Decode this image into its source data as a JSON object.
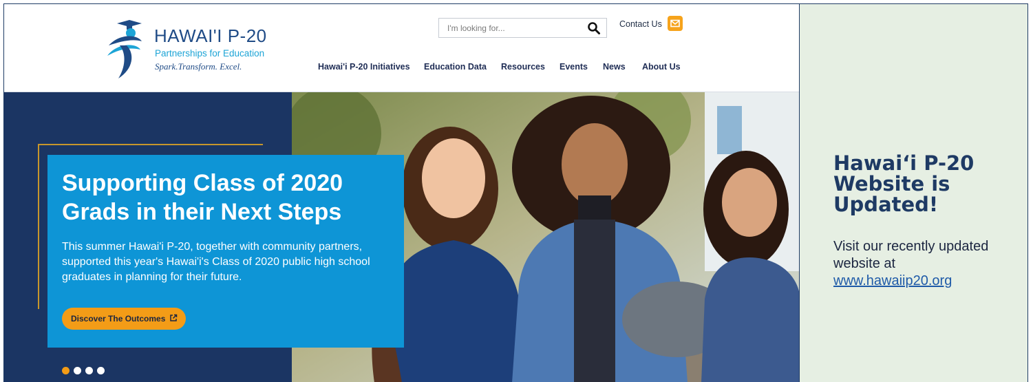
{
  "header": {
    "logo": {
      "title": "HAWAI'I P-20",
      "subtitle": "Partnerships for Education",
      "tagline": "Spark.Transform. Excel."
    },
    "search": {
      "placeholder": "I'm looking for...",
      "value": ""
    },
    "contact_label": "Contact Us",
    "nav": [
      {
        "label": "Hawai'i P-20 Initiatives"
      },
      {
        "label": "Education Data"
      },
      {
        "label": "Resources"
      },
      {
        "label": "Events"
      },
      {
        "label": "News"
      },
      {
        "label": "About Us"
      }
    ]
  },
  "hero": {
    "title": "Supporting Class of 2020 Grads in their Next Steps",
    "text": "This summer Hawai'i P-20, together with community partners, supported this year's Hawai'i's Class of 2020 public high school graduates in planning for their future.",
    "button_label": "Discover The Outcomes",
    "slides_total": 4,
    "slide_active": 1
  },
  "announcement": {
    "title": "Hawai‘i P-20 Website is Updated!",
    "body": "Visit our recently updated website at",
    "link": "www.hawaiip20.org"
  },
  "colors": {
    "navy": "#1b3563",
    "promo_blue": "#0e95d6",
    "accent_orange": "#f39c17",
    "panel_green": "#e6efe3"
  },
  "icons": [
    "logo-figure-icon",
    "search-icon",
    "mail-icon",
    "external-link-icon"
  ]
}
